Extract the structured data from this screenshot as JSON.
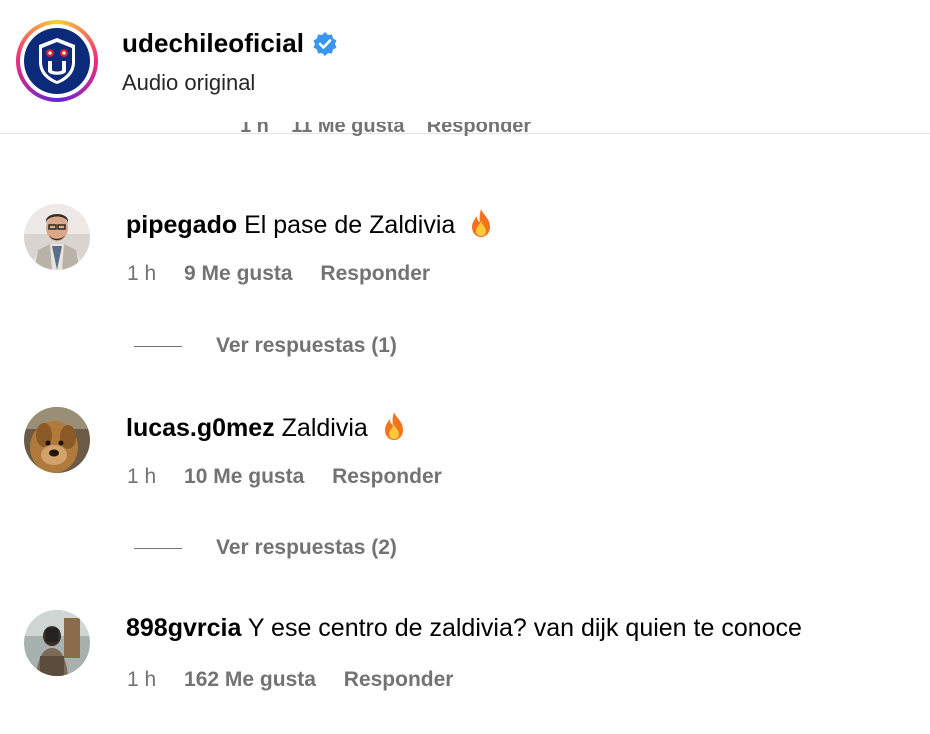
{
  "header": {
    "username": "udechileoficial",
    "subtitle": "Audio original",
    "verified_icon": "verified-badge-icon",
    "brand_color": "#0b2a7a",
    "verified_color": "#3897f0"
  },
  "cutoff_row": {
    "text": "1 h    11 Me gusta    Responder"
  },
  "comments": [
    {
      "username": "pipegado",
      "text": "El pase de Zaldivia",
      "emoji": "fire-icon",
      "time": "1 h",
      "likes": "9 Me gusta",
      "reply": "Responder",
      "replies_label": "Ver respuestas (1)"
    },
    {
      "username": "lucas.g0mez",
      "text": "Zaldivia",
      "emoji": "fire-icon",
      "time": "1 h",
      "likes": "10 Me gusta",
      "reply": "Responder",
      "replies_label": "Ver respuestas (2)"
    },
    {
      "username": "898gvrcia",
      "text": "Y ese centro de zaldivia? van dijk quien te conoce",
      "time": "1 h",
      "likes": "162 Me gusta",
      "reply": "Responder"
    }
  ]
}
